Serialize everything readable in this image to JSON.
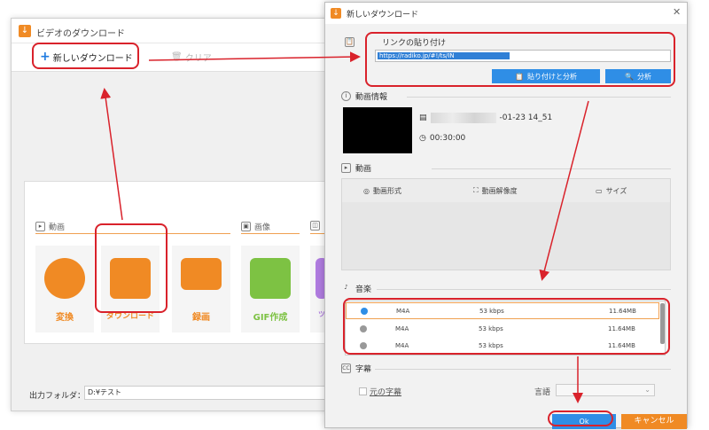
{
  "main_window": {
    "title": "ビデオのダウンロード",
    "toolbar": {
      "new_download": "新しいダウンロード",
      "clear": "クリア"
    },
    "categories": {
      "video": "動画",
      "image": "画像"
    },
    "tiles": [
      {
        "label": "変換",
        "icon": "film-icon",
        "color": "#f08a24"
      },
      {
        "label": "ダウンロード",
        "icon": "download-icon",
        "color": "#f08a24"
      },
      {
        "label": "録画",
        "icon": "screen-record-icon",
        "color": "#f08a24"
      },
      {
        "label": "GIF作成",
        "icon": "image-icon",
        "color": "#7dc243"
      },
      {
        "label": "ツ",
        "icon": "tool-icon",
        "color": "#b07ce0"
      }
    ],
    "output_folder_label": "出力フォルダ：",
    "output_folder_value": "D:¥テスト"
  },
  "dialog": {
    "title": "新しいダウンロード",
    "paste_link_label": "リンクの貼り付け",
    "url_value": "https://radiko.jp/#!/ts/IN",
    "paste_analyze_btn": "貼り付けと分析",
    "analyze_btn": "分析",
    "video_info_label": "動画情報",
    "file_name_suffix": "-01-23 14_51",
    "duration": "00:30:00",
    "video_section_label": "動画",
    "video_columns": [
      "動画形式",
      "動画解像度",
      "サイズ"
    ],
    "audio_section_label": "音楽",
    "audio_rows": [
      {
        "format": "M4A",
        "bitrate": "53 kbps",
        "size": "11.64MB",
        "selected": true
      },
      {
        "format": "M4A",
        "bitrate": "53 kbps",
        "size": "11.64MB",
        "selected": false
      },
      {
        "format": "M4A",
        "bitrate": "53 kbps",
        "size": "11.64MB",
        "selected": false
      }
    ],
    "subtitle_section_label": "字幕",
    "original_subtitle": "元の字幕",
    "language_label": "言語",
    "ok_btn": "Ok",
    "cancel_btn": "キャンセル"
  },
  "colors": {
    "accent_blue": "#2f8ee6",
    "accent_orange": "#f08a24",
    "highlight_red": "#d9222b"
  }
}
